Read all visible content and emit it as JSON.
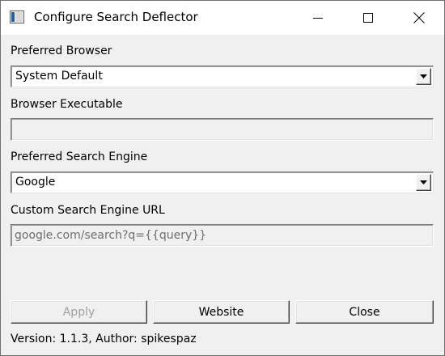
{
  "window": {
    "title": "Configure Search Deflector",
    "controls": {
      "minimize": "minimize-icon",
      "maximize": "maximize-icon",
      "close": "close-icon"
    }
  },
  "browser": {
    "label": "Preferred Browser",
    "selected": "System Default"
  },
  "executable": {
    "label": "Browser Executable",
    "value": ""
  },
  "engine": {
    "label": "Preferred Search Engine",
    "selected": "Google"
  },
  "custom_url": {
    "label": "Custom Search Engine URL",
    "value": "google.com/search?q={{query}}"
  },
  "buttons": {
    "apply": "Apply",
    "website": "Website",
    "close": "Close"
  },
  "status": "Version: 1.1.3, Author: spikespaz",
  "colors": {
    "window_bg": "#f0f0f0",
    "titlebar_bg": "#ffffff",
    "disabled_text": "#a0a0a0",
    "readonly_text": "#6d6d6d"
  }
}
